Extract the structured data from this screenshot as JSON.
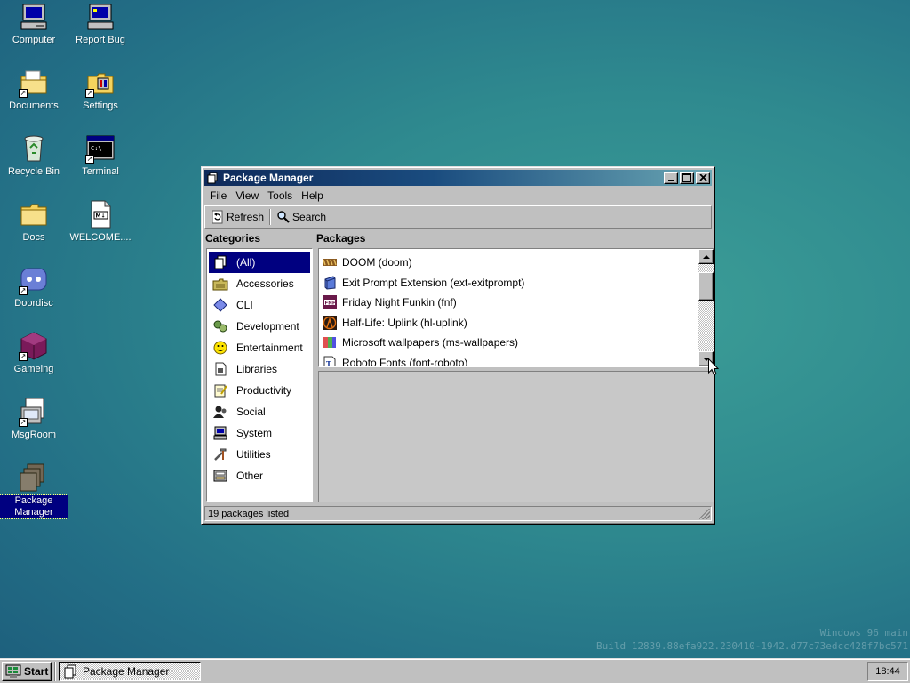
{
  "desktop": {
    "icons": [
      {
        "label": "Computer",
        "icon": "computer-icon"
      },
      {
        "label": "Report Bug",
        "icon": "report-bug-icon"
      },
      {
        "label": "Documents",
        "icon": "documents-folder-icon"
      },
      {
        "label": "Settings",
        "icon": "settings-folder-icon"
      },
      {
        "label": "Recycle Bin",
        "icon": "recycle-bin-icon"
      },
      {
        "label": "Terminal",
        "icon": "terminal-icon"
      },
      {
        "label": "Docs",
        "icon": "docs-folder-icon"
      },
      {
        "label": "WELCOME....",
        "icon": "markdown-file-icon"
      },
      {
        "label": "Doordisc",
        "icon": "doordisc-icon"
      },
      {
        "label": "Gameing",
        "icon": "gameing-icon"
      },
      {
        "label": "MsgRoom",
        "icon": "msgroom-icon"
      },
      {
        "label": "Package Manager",
        "icon": "package-manager-icon",
        "selected": true
      }
    ]
  },
  "window": {
    "title": "Package Manager",
    "menu": [
      "File",
      "View",
      "Tools",
      "Help"
    ],
    "toolbar": {
      "refresh_label": "Refresh",
      "search_label": "Search"
    },
    "categories_header": "Categories",
    "packages_header": "Packages",
    "categories": [
      {
        "label": "(All)",
        "icon": "all-icon",
        "selected": true
      },
      {
        "label": "Accessories",
        "icon": "accessories-icon"
      },
      {
        "label": "CLI",
        "icon": "cli-icon"
      },
      {
        "label": "Development",
        "icon": "development-icon"
      },
      {
        "label": "Entertainment",
        "icon": "entertainment-icon"
      },
      {
        "label": "Libraries",
        "icon": "libraries-icon"
      },
      {
        "label": "Productivity",
        "icon": "productivity-icon"
      },
      {
        "label": "Social",
        "icon": "social-icon"
      },
      {
        "label": "System",
        "icon": "system-icon"
      },
      {
        "label": "Utilities",
        "icon": "utilities-icon"
      },
      {
        "label": "Other",
        "icon": "other-icon"
      }
    ],
    "packages": [
      {
        "label": "DOOM (doom)",
        "icon": "doom-icon"
      },
      {
        "label": "Exit Prompt Extension (ext-exitprompt)",
        "icon": "extension-icon"
      },
      {
        "label": "Friday Night Funkin (fnf)",
        "icon": "fnf-icon"
      },
      {
        "label": "Half-Life: Uplink (hl-uplink)",
        "icon": "half-life-icon"
      },
      {
        "label": "Microsoft wallpapers (ms-wallpapers)",
        "icon": "wallpapers-icon"
      },
      {
        "label": "Roboto Fonts (font-roboto)",
        "icon": "font-icon"
      }
    ],
    "status": "19 packages listed"
  },
  "watermark": {
    "line1": "Windows 96 main",
    "line2": "Build 12839.88efa922.230410-1942.d77c73edcc428f7bc571"
  },
  "taskbar": {
    "start_label": "Start",
    "tasks": [
      {
        "label": "Package Manager"
      }
    ],
    "clock": "18:44"
  }
}
